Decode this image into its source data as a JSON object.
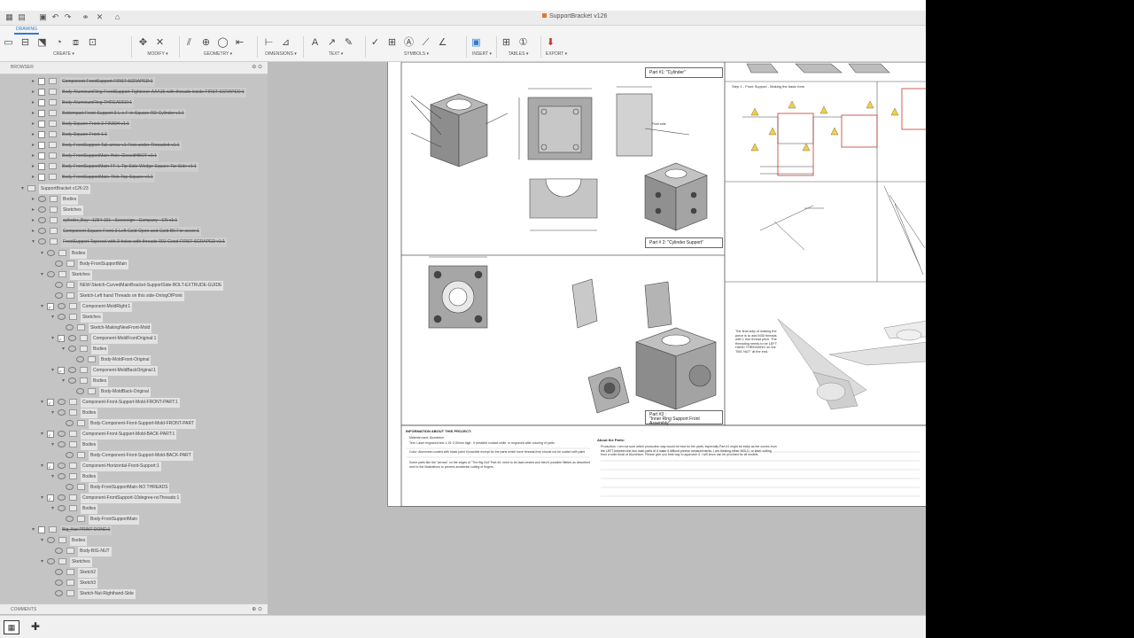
{
  "window": {
    "title": "SupportBracket v126"
  },
  "quick_access": [
    "grid-icon",
    "file-icon",
    "save-icon",
    "undo-icon",
    "redo-icon",
    "home-icon"
  ],
  "ribbon": {
    "workspace_tab": "DRAWING",
    "groups": [
      {
        "label": "CREATE ▾"
      },
      {
        "label": "MODIFY ▾"
      },
      {
        "label": "GEOMETRY ▾"
      },
      {
        "label": "DIMENSIONS ▾"
      },
      {
        "label": "TEXT ▾"
      },
      {
        "label": "SYMBOLS ▾"
      },
      {
        "label": "INSERT ▾"
      },
      {
        "label": "TABLES ▾"
      },
      {
        "label": "EXPORT ▾"
      }
    ]
  },
  "browser": {
    "header": "BROWSER",
    "items": [
      {
        "label": "Component-FrontSupport-FIRST-SCRAPED:1",
        "struck": true
      },
      {
        "label": "Body-AluminumRing-FrontSupport-Tightener-AAA15-with-threads-inside-FIRST-SCRAPED:1",
        "struck": true
      },
      {
        "label": "Body-AluminumRing-THREADED:1",
        "struck": true
      },
      {
        "label": "Bottompart-Front-Support-3-L-x-F-in-Square-RD-Cylinder v1:1",
        "struck": true
      },
      {
        "label": "Body-Square-Front-3-FINISH v1:1",
        "struck": true
      },
      {
        "label": "Body-Square-Front-1:1",
        "struck": true
      },
      {
        "label": "Body-FrontSupport-Tail-arrow-v1-First-under-Threaded-v1:1",
        "struck": true
      },
      {
        "label": "Body-FrontSupportMain-Hole-ClosedHBOT v1:1",
        "struck": true
      },
      {
        "label": "Body-FrontSupportMain-FF-L-Tip-Side-Wedge-Square-Tar-Side v1:1",
        "struck": true
      },
      {
        "label": "Body-FrontSupportMain-Thin-Top-Square v1:1",
        "struck": true
      },
      {
        "label": "SupportBracket v126:23"
      },
      {
        "label": "Bodies"
      },
      {
        "label": "Sketches"
      },
      {
        "label": "cylinder_Bay - 1254-101 - Sovereign - Company - EN v1:1",
        "struck": true
      },
      {
        "label": "Component-Square-Front-3-Left-Cold-Open-and-Cold-Bit-For-cover:1",
        "struck": true
      },
      {
        "label": "FrontSupport-Tapered-with-3-holes-with-threads-001-Good-FIRST-SCRAPED v1:1",
        "struck": true
      },
      {
        "label": "Bodies"
      },
      {
        "label": "Body-FrontSupportMain"
      },
      {
        "label": "Sketches"
      },
      {
        "label": "NEW-Sketch-CurvedMainBracket-SupportSide-BOLT-EXTRUDE-GUIDE"
      },
      {
        "label": "Sketch-Left hand Threads on this side-OnlogOfPoint"
      },
      {
        "label": "Component-MoldRight:1"
      },
      {
        "label": "Sketches"
      },
      {
        "label": "Sketch-MakingNewFront-Mold"
      },
      {
        "label": "Component-MoldFrontOriginal:1"
      },
      {
        "label": "Bodies"
      },
      {
        "label": "Body-MoldFront-Original"
      },
      {
        "label": "Component-MoldBackOriginal:1"
      },
      {
        "label": "Bodies"
      },
      {
        "label": "Body-MoldBack-Original"
      },
      {
        "label": "Component-Front-Support-Mold-FRONT-PART:1"
      },
      {
        "label": "Bodies"
      },
      {
        "label": "Body-Component-Front-Support-Mold-FRONT-PART"
      },
      {
        "label": "Component-Front-Support-Mold-BACK-PART:1"
      },
      {
        "label": "Bodies"
      },
      {
        "label": "Body-Component-Front-Support-Mold-BACK-PART"
      },
      {
        "label": "Component-Horizontal-Front-Support:1"
      },
      {
        "label": "Bodies"
      },
      {
        "label": "Body-FrontSupportMain-NO THREADS"
      },
      {
        "label": "Component-FrontSupport-10degree-noThreads:1"
      },
      {
        "label": "Bodies"
      },
      {
        "label": "Body-FrontSupportMain"
      },
      {
        "label": "Big_Nut-PRINT-DONE:1",
        "struck": true
      },
      {
        "label": "Bodies"
      },
      {
        "label": "Body-BIG-NUT"
      },
      {
        "label": "Sketches"
      },
      {
        "label": "Sketch2"
      },
      {
        "label": "Sketch3"
      },
      {
        "label": "Sketch-Nut-Righthand-Side"
      }
    ],
    "comments_label": "COMMENTS"
  },
  "drawing": {
    "part1_caption": "Part #1: \"Cylinder\"",
    "part2_caption": "Part # 2: \"Cylinder Support\"",
    "part3_caption_line1": "Part #3 :",
    "part3_caption_line2": "\"Inner Ring Support Front Assembly\"",
    "front_hole_label": "Front side",
    "right_note": "The final step of making the piece is to add M30 threads with 1 mm thread pitch. The threading needs to be LEFT HAND THREADING on the \"BIG NUT\" at the end.",
    "step1_label": "Step 1 - Front Support - Making the basic form",
    "info_title": "INFORMATION ABOUT THIS PROJECT:",
    "parts_title": "About the Parts:",
    "material_label": "Material used: Aluminium",
    "text_note": "Text: Laser engraved text 1,15~2,50mm digit - If possible contact while, or engraved after coloring of parts",
    "color_note": "Color: Aluminium coated with black paint if possible except for the parts which have threads,they should not be coated with paint",
    "arrow_note": "Some parts like the \"arrows\" on the edges of \"The Big Nut\" Part #4, need to be laser-tested and tried if possible filleted as described next to the illustrations to prevent accidental cutting of fingers.",
    "parts_note": "Production: I am not sure which production way would be best for the parts, especially Part #1 might be tricky as the curves from the LEFT between the two main parts of it make it difficult precise measurements. I am thinking either MOLD, or laser cutting from a solid block of Aluminium. Please give you best way to approach it. I will show can be provided for all models."
  }
}
